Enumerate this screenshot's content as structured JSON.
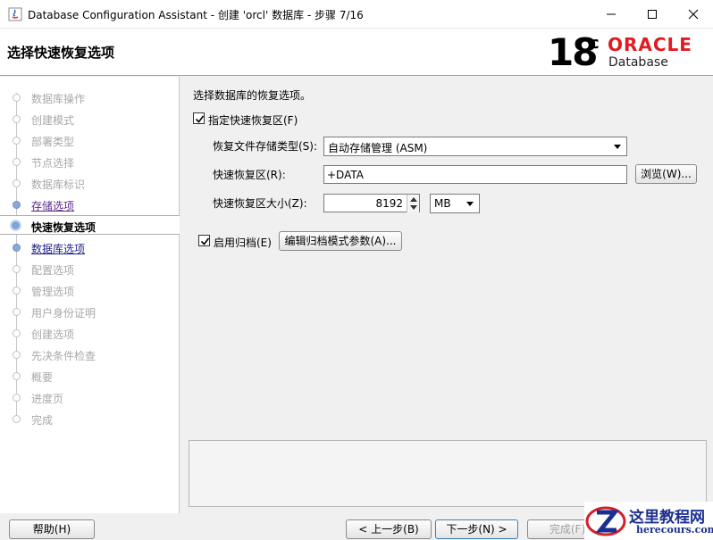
{
  "window": {
    "title": "Database Configuration Assistant - 创建 'orcl' 数据库 - 步骤 7/16"
  },
  "header": {
    "page_title": "选择快速恢复选项",
    "version_number": "18",
    "version_sup": "c",
    "brand": "ORACLE",
    "product": "Database"
  },
  "nav": {
    "items": [
      {
        "label": "数据库操作",
        "state": "disabled"
      },
      {
        "label": "创建模式",
        "state": "disabled"
      },
      {
        "label": "部署类型",
        "state": "disabled"
      },
      {
        "label": "节点选择",
        "state": "disabled"
      },
      {
        "label": "数据库标识",
        "state": "disabled"
      },
      {
        "label": "存储选项",
        "state": "visited-link"
      },
      {
        "label": "快速恢复选项",
        "state": "current"
      },
      {
        "label": "数据库选项",
        "state": "link"
      },
      {
        "label": "配置选项",
        "state": "disabled"
      },
      {
        "label": "管理选项",
        "state": "disabled"
      },
      {
        "label": "用户身份证明",
        "state": "disabled"
      },
      {
        "label": "创建选项",
        "state": "disabled"
      },
      {
        "label": "先决条件检查",
        "state": "disabled"
      },
      {
        "label": "概要",
        "state": "disabled"
      },
      {
        "label": "进度页",
        "state": "disabled"
      },
      {
        "label": "完成",
        "state": "disabled"
      }
    ]
  },
  "content": {
    "intro": "选择数据库的恢复选项。",
    "specify_fra": {
      "label": "指定快速恢复区(F)",
      "checked": true
    },
    "storage_type": {
      "label": "恢复文件存储类型(S):",
      "value": "自动存储管理 (ASM)"
    },
    "fra_location": {
      "label": "快速恢复区(R):",
      "value": "+DATA"
    },
    "browse_button": "浏览(W)...",
    "fra_size": {
      "label": "快速恢复区大小(Z):",
      "value": "8192",
      "unit": "MB"
    },
    "enable_archive": {
      "label": "启用归档(E)",
      "checked": true
    },
    "edit_archive_button": "编辑归档模式参数(A)..."
  },
  "footer": {
    "help": "帮助(H)",
    "back": "< 上一步(B)",
    "next": "下一步(N) >",
    "finish": "完成(F)"
  },
  "watermark": {
    "title": "这里教程网",
    "url": "herecours.com"
  },
  "colors": {
    "oracle_red": "#e11b22",
    "nav_link": "#1f1f8a",
    "nav_visited": "#5d2b8c",
    "watermark_blue": "#1c2f8f"
  }
}
